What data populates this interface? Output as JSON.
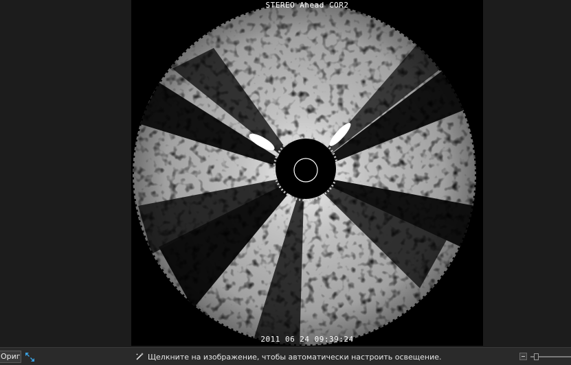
{
  "image": {
    "overlay_title": "STEREO Ahead COR2",
    "overlay_timestamp": "2011 06 24 09:39:24"
  },
  "statusbar": {
    "original_button_label": "Оригинал",
    "hint_text": "Щелкните на изображение, чтобы автоматически настроить освещение.",
    "expand_icon": "expand-arrows-icon",
    "hint_icon": "magic-wand-icon",
    "zoom_level": 0.1
  },
  "colors": {
    "background": "#1c1c1c",
    "statusbar": "#2a2a2a",
    "accent": "#3aa0e0"
  }
}
